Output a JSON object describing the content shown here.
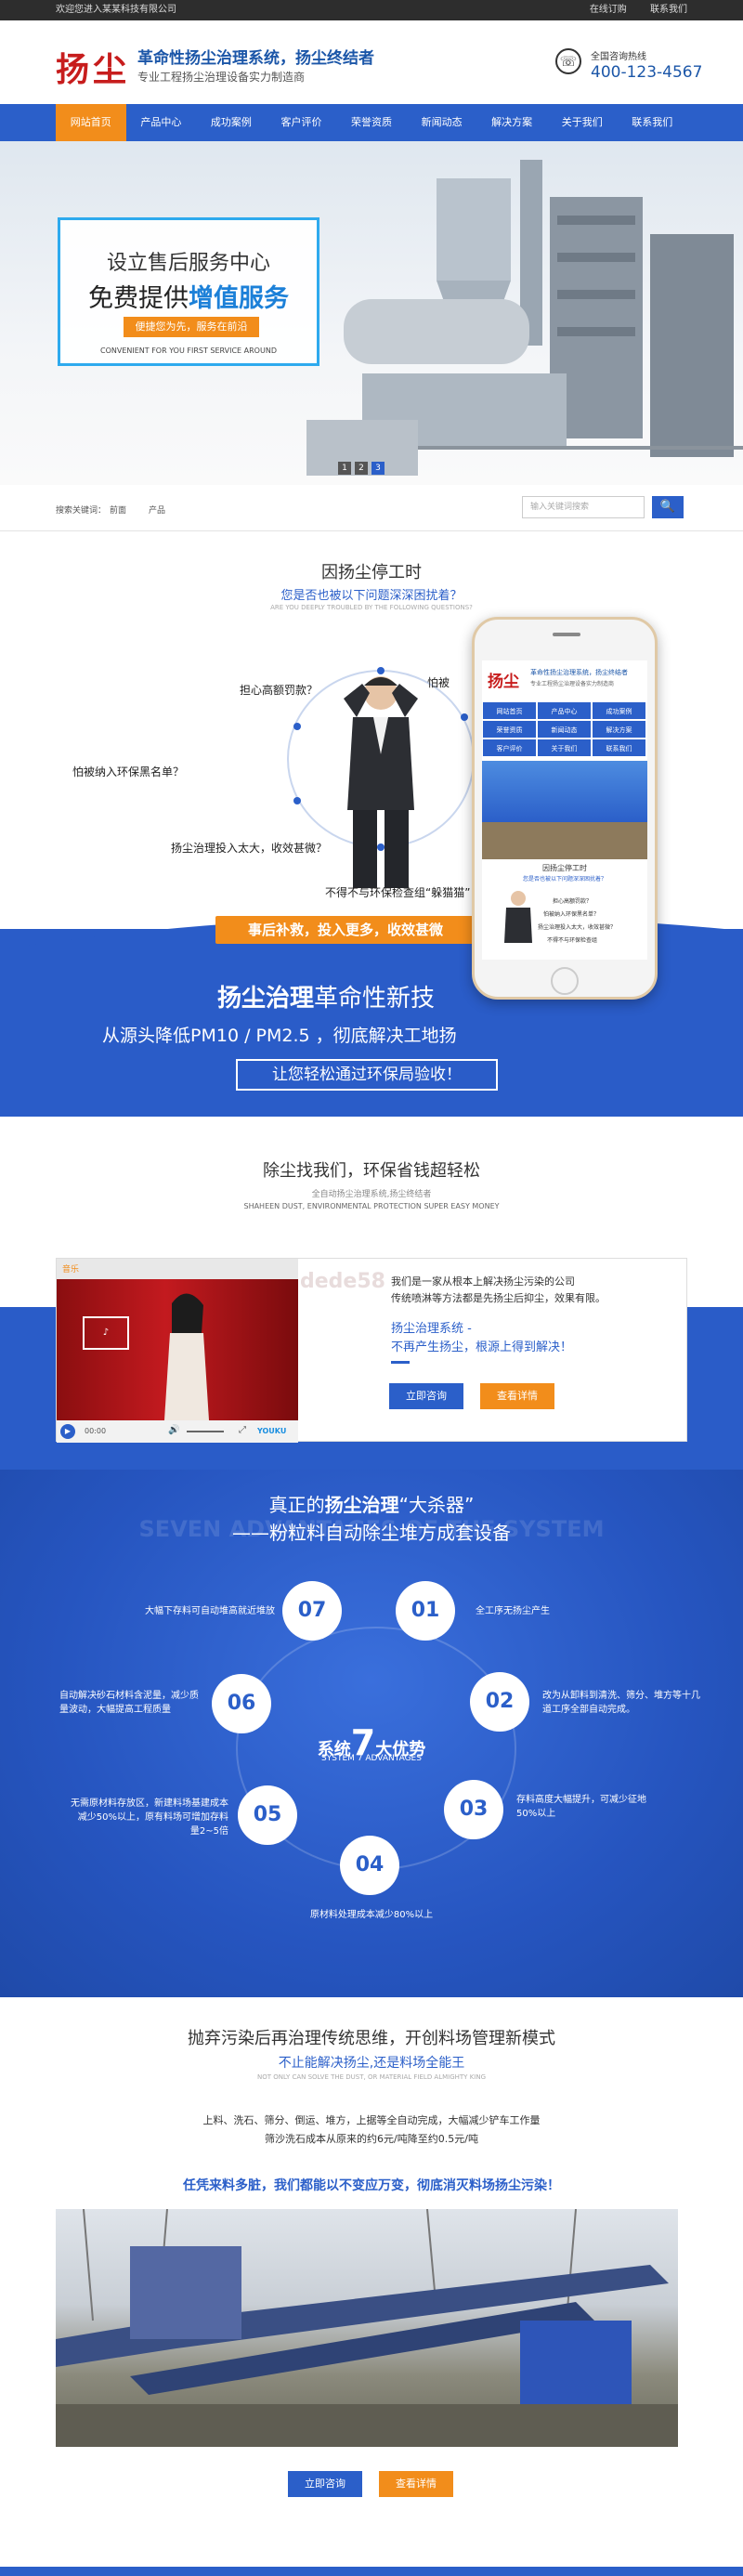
{
  "topbar": {
    "welcome": "欢迎您进入某某科技有限公司",
    "links": [
      "在线订购",
      "联系我们"
    ]
  },
  "header": {
    "logo": "扬尘",
    "slogan_main": "革命性扬尘治理系统，扬尘终结者",
    "slogan_sub": "专业工程扬尘治理设备实力制造商",
    "hotline_label": "全国咨询热线",
    "hotline": "400-123-4567"
  },
  "nav": [
    "网站首页",
    "产品中心",
    "成功案例",
    "客户评价",
    "荣誉资质",
    "新闻动态",
    "解决方案",
    "关于我们",
    "联系我们"
  ],
  "banner": {
    "line1": "设立售后服务中心",
    "line2_a": "免费提供",
    "line2_b": "增值服务",
    "tag": "便捷您为先，服务在前沿",
    "line3": "CONVENIENT FOR YOU FIRST  SERVICE AROUND",
    "pages": [
      "1",
      "2",
      "3"
    ]
  },
  "search": {
    "label": "搜索关键词：",
    "keywords": [
      "前面",
      "产品"
    ],
    "placeholder": "输入关键词搜索",
    "btn": "🔍"
  },
  "sec2": {
    "title": "因扬尘停工时",
    "subtitle": "您是否也被以下问题深深困扰着？",
    "en": "ARE YOU DEEPLY TROUBLED BY THE FOLLOWING QUESTIONS?",
    "questions": [
      "担心高额罚款？",
      "怕被",
      "怕被纳入环保黑名单？",
      "扬尘治理投入太大，收效甚微？",
      "不得不与环保检查组“躲猫猫”"
    ],
    "orange": "事后补救，投入更多，收效甚微",
    "big_a": "扬尘治理",
    "big_b": "革命性新技",
    "mid": "从源头降低PM10 / PM2.5 ，彻底解决工地扬",
    "btn": "让您轻松通过环保局验收！",
    "phone": {
      "slogan": "革命性扬尘治理系统，扬尘终结者",
      "sub": "专业工程扬尘治理设备实力制造商",
      "nav": [
        "网站首页",
        "产品中心",
        "成功案例",
        "荣誉资质",
        "新闻动态",
        "解决方案",
        "客户评价",
        "关于我们",
        "联系我们"
      ],
      "s_title": "因扬尘停工时",
      "s_sub": "您是否也被以下问题深深困扰着？",
      "q1": "担心高额罚款？",
      "q2": "怕被纳入环保黑名单？",
      "q3": "扬尘治理投入太大，收效甚微？",
      "q4": "不得不与环保检查组"
    }
  },
  "sec3": {
    "title": "除尘找我们，环保省钱超轻松",
    "sub": "全自动扬尘治理系统,扬尘终结者",
    "en": "SHAHEEN DUST, ENVIRONMENTAL PROTECTION SUPER EASY MONEY",
    "desc1": "我们是一家从根本上解决扬尘污染的公司",
    "desc2": "传统喷淋等方法都是先扬尘后抑尘，效果有限。",
    "hl1": "扬尘治理系统 -",
    "hl2": "不再产生扬尘，根源上得到解决！",
    "btn1": "立即咨询",
    "btn2": "查看详情",
    "video": {
      "brand": "音乐",
      "time": "00:00",
      "logo": "YOUKU",
      "watermark": "dede58"
    }
  },
  "sec4": {
    "title_a": "真正的",
    "title_b": "扬尘治理",
    "title_c": "“大杀器”",
    "title2": "——粉粒料自动除尘堆方成套设备",
    "bg_en": "SEVEN ADVANTAGES OF THE SYSTEM",
    "center_a": "系统",
    "center_num": "7",
    "center_b": "大优势",
    "center_en": "SYSTEM 7 ADVANTAGES",
    "items": [
      {
        "n": "01",
        "t": "全工序无扬尘产生"
      },
      {
        "n": "02",
        "t": "改为从卸料到清洗、筛分、堆方等十几道工序全部自动完成。"
      },
      {
        "n": "03",
        "t": "存料高度大幅提升，可减少征地50%以上"
      },
      {
        "n": "04",
        "t": "原材料处理成本减少80%以上"
      },
      {
        "n": "05",
        "t": "无需原材料存放区，新建料场基建成本减少50%以上，原有料场可增加存料量2~5倍"
      },
      {
        "n": "06",
        "t": "自动解决砂石材料含泥量，减少质量波动，大幅提高工程质量"
      },
      {
        "n": "07",
        "t": "大幅下存料可自动堆高就近堆放"
      }
    ]
  },
  "sec5": {
    "title": "抛弃污染后再治理传统思维，开创料场管理新模式",
    "sub": "不止能解决扬尘,还是料场全能王",
    "en": "NOT ONLY CAN SOLVE THE DUST, OR MATERIAL FIELD ALMIGHTY KING",
    "p1": "上料、洗石、筛分、倒运、堆方，上据等全自动完成，大幅减少铲车工作量",
    "p2": "筛沙洗石成本从原来的约6元/吨降至约0.5元/吨",
    "highlight": "任凭来料多脏，我们都能以不变应万变，彻底消灭料场扬尘污染！",
    "btn1": "立即咨询",
    "btn2": "查看详情"
  },
  "colors": {
    "blue": "#2b5fc9",
    "orange": "#f28d1b",
    "red": "#c71d1d",
    "dark": "#2d2d2d"
  }
}
